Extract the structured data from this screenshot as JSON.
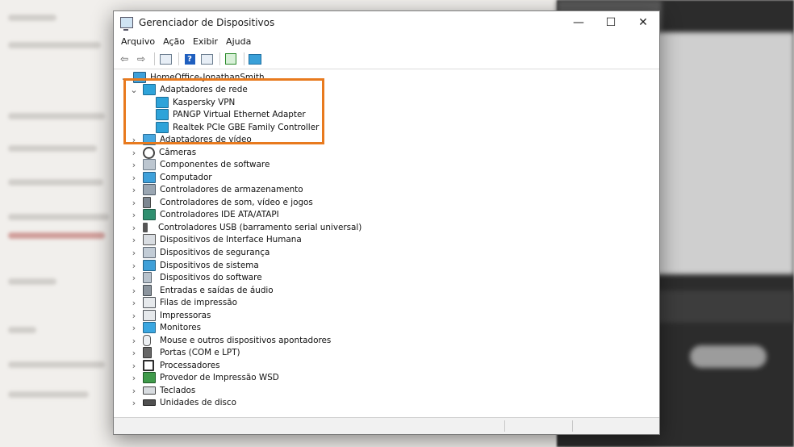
{
  "window": {
    "title": "Gerenciador de Dispositivos",
    "controls": {
      "minimize": "—",
      "maximize": "☐",
      "close": "✕"
    }
  },
  "menu": [
    "Arquivo",
    "Ação",
    "Exibir",
    "Ajuda"
  ],
  "toolbar": {
    "back": "⇦",
    "forward": "⇨",
    "help": "?"
  },
  "tree": {
    "root": "HomeOffice-JonathanSmith",
    "expanded_category": "Adaptadores de rede",
    "children": [
      "Kaspersky VPN",
      "PANGP Virtual Ethernet Adapter",
      "Realtek PCIe GBE Family Controller"
    ],
    "categories": [
      "Adaptadores de vídeo",
      "Câmeras",
      "Componentes de software",
      "Computador",
      "Controladores de armazenamento",
      "Controladores de som, vídeo e jogos",
      "Controladores IDE ATA/ATAPI",
      "Controladores USB (barramento serial universal)",
      "Dispositivos de Interface Humana",
      "Dispositivos de segurança",
      "Dispositivos de sistema",
      "Dispositivos do software",
      "Entradas e saídas de áudio",
      "Filas de impressão",
      "Impressoras",
      "Monitores",
      "Mouse e outros dispositivos apontadores",
      "Portas (COM e LPT)",
      "Processadores",
      "Provedor de Impressão WSD",
      "Teclados",
      "Unidades de disco"
    ],
    "chevron_expanded": "⌄",
    "chevron_collapsed": "›"
  },
  "highlight_color": "#e87a1e"
}
